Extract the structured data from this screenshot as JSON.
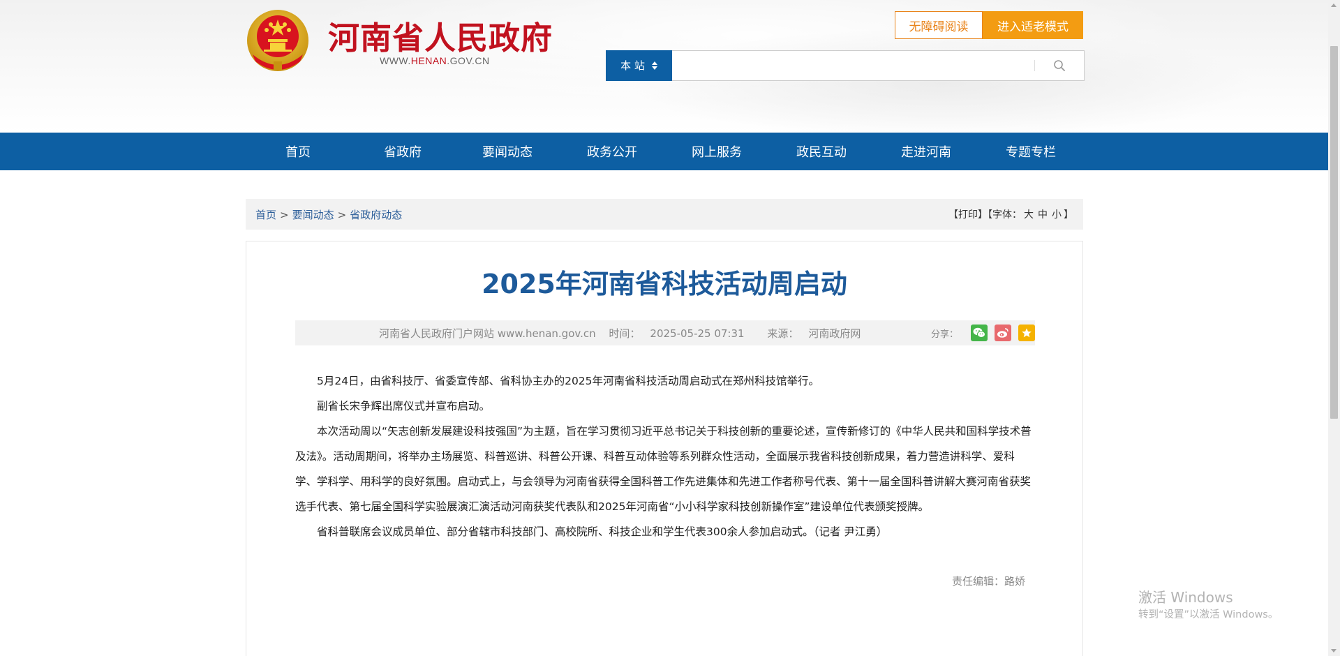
{
  "header": {
    "site_name": "河南省人民政府",
    "url_prefix": "WWW.",
    "url_brand": "HENAN",
    "url_suffix": ".GOV.CN",
    "accessible_label": "无障碍阅读",
    "elder_mode_label": "进入适老模式",
    "search_scope": "本 站",
    "search_value": ""
  },
  "nav": {
    "items": [
      "首页",
      "省政府",
      "要闻动态",
      "政务公开",
      "网上服务",
      "政民互动",
      "走进河南",
      "专题专栏"
    ]
  },
  "breadcrumb": {
    "items": [
      "首页",
      "要闻动态",
      "省政府动态"
    ],
    "separator": ">",
    "print_label": "【打印】",
    "font_label_open": "【字体：",
    "font_large": "大",
    "font_medium": "中",
    "font_small": "小",
    "font_label_close": "】"
  },
  "article": {
    "title": "2025年河南省科技活动周启动",
    "source_site": "河南省人民政府门户网站 www.henan.gov.cn",
    "time_label": "时间：",
    "time": "2025-05-25 07:31",
    "origin_label": "来源：",
    "origin": "河南政府网",
    "share_label": "分享：",
    "paragraphs": [
      "5月24日，由省科技厅、省委宣传部、省科协主办的2025年河南省科技活动周启动式在郑州科技馆举行。",
      "副省长宋争辉出席仪式并宣布启动。",
      "本次活动周以“矢志创新发展建设科技强国”为主题，旨在学习贯彻习近平总书记关于科技创新的重要论述，宣传新修订的《中华人民共和国科学技术普及法》。活动周期间，将举办主场展览、科普巡讲、科普公开课、科普互动体验等系列群众性活动，全面展示我省科技创新成果，着力营造讲科学、爱科学、学科学、用科学的良好氛围。启动式上，与会领导为河南省获得全国科普工作先进集体和先进工作者称号代表、第十一届全国科普讲解大赛河南省获奖选手代表、第七届全国科学实验展演汇演活动河南获奖代表队和2025年河南省“小小科学家科技创新操作室”建设单位代表颁奖授牌。",
      "省科普联席会议成员单位、部分省辖市科技部门、高校院所、科技企业和学生代表300余人参加启动式。（记者 尹江勇）"
    ],
    "editor": "责任编辑：路娇"
  },
  "watermark": {
    "line1": "激活 Windows",
    "line2": "转到“设置”以激活 Windows。"
  },
  "colors": {
    "brand_red": "#c1121f",
    "nav_blue": "#0d5fa3",
    "title_blue": "#1d5a9a",
    "orange": "#f39c12"
  }
}
